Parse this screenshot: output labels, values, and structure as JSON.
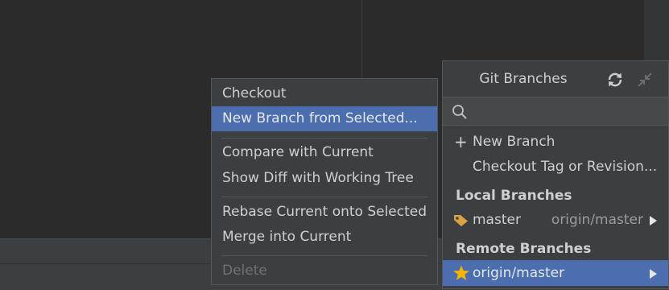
{
  "context_menu": {
    "items": [
      {
        "label": "Checkout",
        "state": "normal"
      },
      {
        "label": "New Branch from Selected...",
        "state": "selected"
      },
      {
        "label": "Compare with Current",
        "state": "normal"
      },
      {
        "label": "Show Diff with Working Tree",
        "state": "normal"
      },
      {
        "label": "Rebase Current onto Selected",
        "state": "normal"
      },
      {
        "label": "Merge into Current",
        "state": "normal"
      },
      {
        "label": "Delete",
        "state": "disabled"
      }
    ]
  },
  "git_branches": {
    "title": "Git Branches",
    "search": {
      "value": "",
      "placeholder": ""
    },
    "actions": {
      "new_branch": "New Branch",
      "checkout_tag": "Checkout Tag or Revision..."
    },
    "local_section": "Local Branches",
    "local_branches": [
      {
        "name": "master",
        "tracking": "origin/master"
      }
    ],
    "remote_section": "Remote Branches",
    "remote_branches": [
      {
        "name": "origin/master"
      }
    ]
  },
  "colors": {
    "selection": "#4b6eaf",
    "tag": "#d9a343",
    "star": "#f4b400"
  },
  "icons": [
    "refresh-icon",
    "collapse-icon",
    "search-icon",
    "plus-icon",
    "tag-icon",
    "star-icon",
    "submenu-arrow-icon"
  ]
}
